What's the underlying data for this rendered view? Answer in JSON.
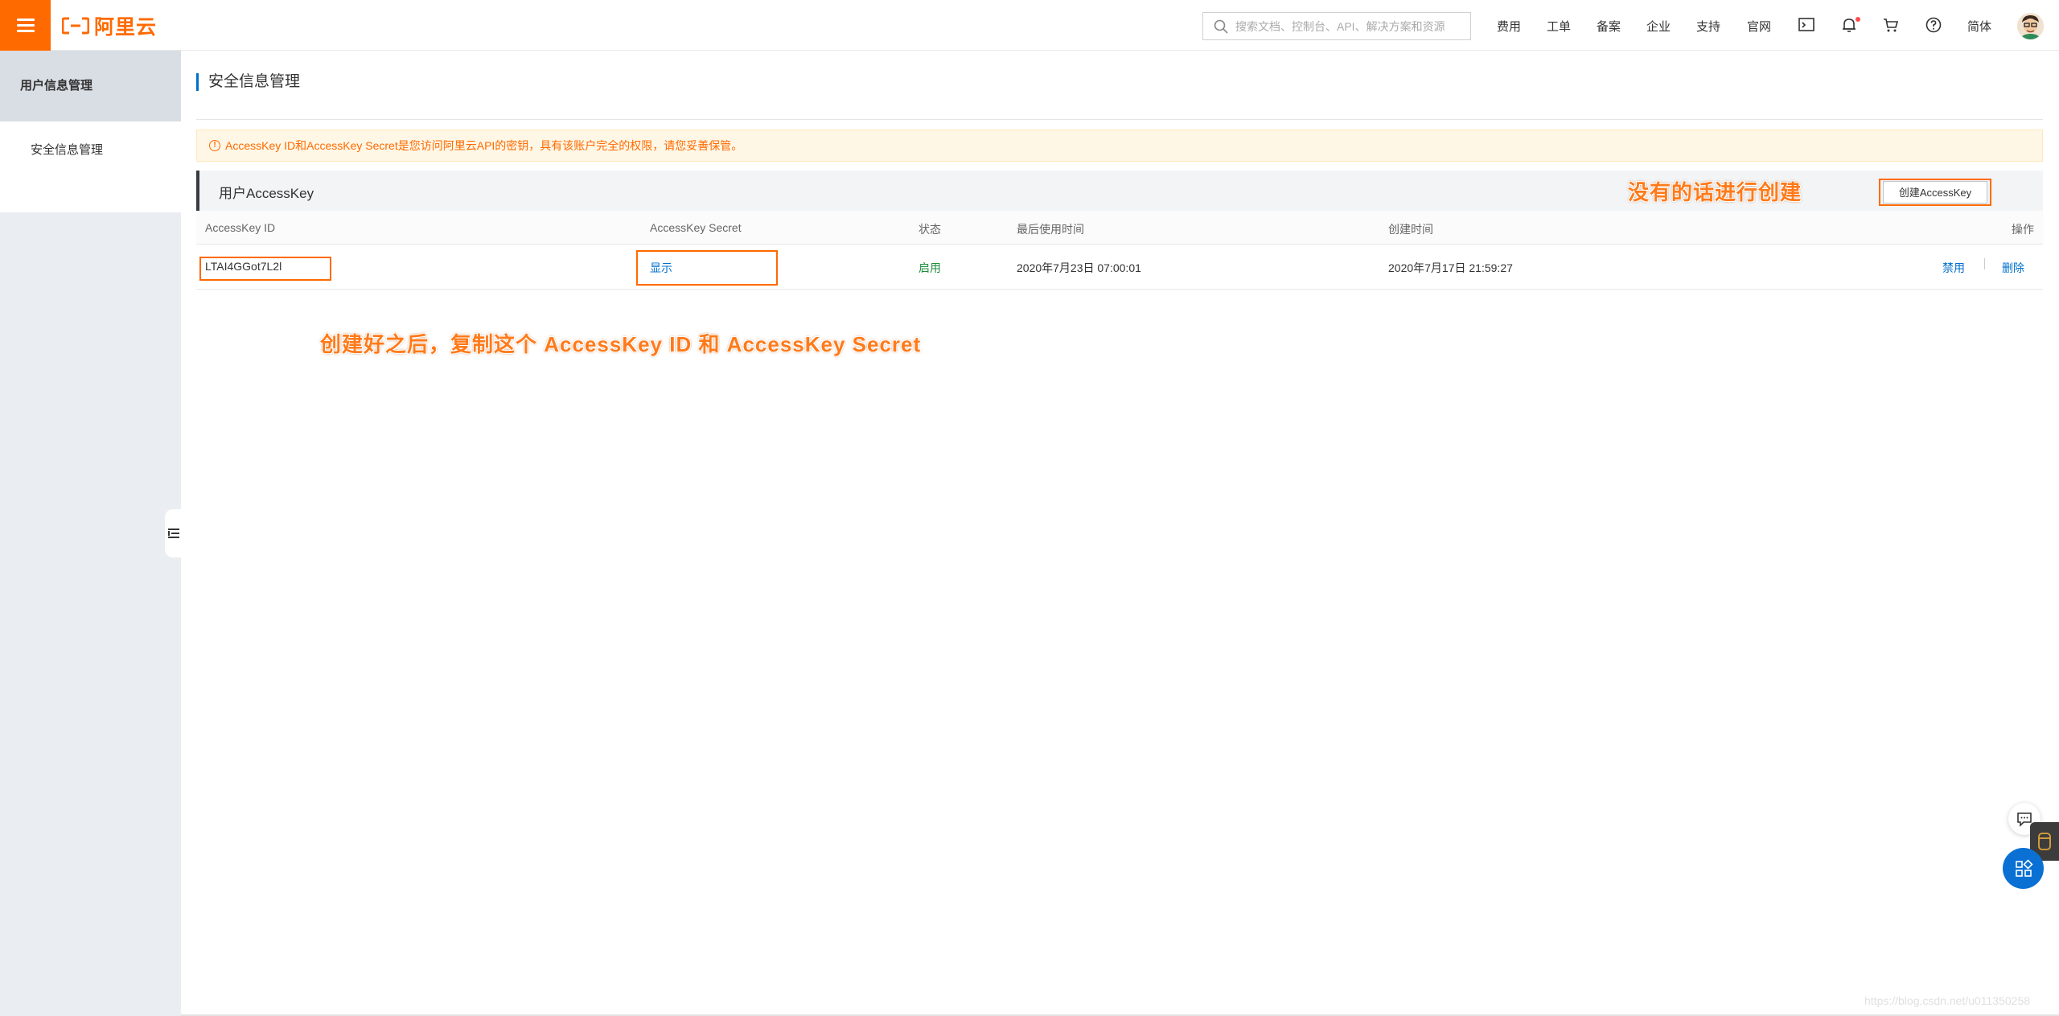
{
  "header": {
    "logo_text": "阿里云",
    "search_placeholder": "搜索文档、控制台、API、解决方案和资源",
    "nav": [
      "费用",
      "工单",
      "备案",
      "企业",
      "支持",
      "官网"
    ],
    "lang": "简体",
    "icons": [
      "terminal-icon",
      "bell-icon",
      "cart-icon",
      "help-icon"
    ]
  },
  "sidebar": {
    "title": "用户信息管理",
    "items": [
      {
        "label": "安全信息管理"
      }
    ]
  },
  "main": {
    "page_title": "安全信息管理",
    "alert": "AccessKey ID和AccessKey Secret是您访问阿里云API的密钥，具有该账户完全的权限，请您妥善保管。",
    "panel_title": "用户AccessKey",
    "create_button": "创建AccessKey",
    "table": {
      "columns": [
        "AccessKey ID",
        "AccessKey Secret",
        "状态",
        "最后使用时间",
        "创建时间",
        "操作"
      ],
      "rows": [
        {
          "id": "LTAI4GGot7L2l",
          "secret": "显示",
          "status": "启用",
          "last_used": "2020年7月23日 07:00:01",
          "created": "2020年7月17日 21:59:27",
          "actions": [
            "禁用",
            "删除"
          ]
        }
      ]
    }
  },
  "annotations": {
    "create_hint": "没有的话进行创建",
    "copy_hint": "创建好之后，复制这个 AccessKey ID 和 AccessKey Secret"
  },
  "watermark": "https://blog.csdn.net/u011350258",
  "colors": {
    "brand": "#ff6a00",
    "link": "#0070cc",
    "success": "#1e8e3e",
    "annotation": "#ff7a1a"
  }
}
